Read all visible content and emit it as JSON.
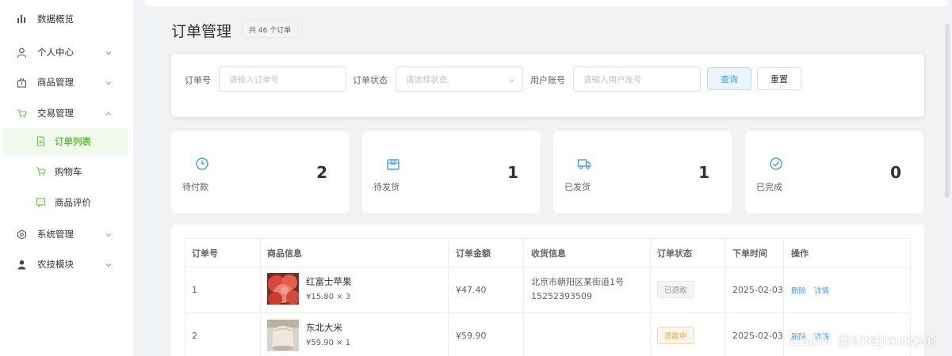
{
  "sidebar": {
    "items": [
      {
        "label": "数据概览",
        "icon": "bar-chart-icon"
      },
      {
        "label": "个人中心",
        "icon": "user-icon"
      },
      {
        "label": "商品管理",
        "icon": "goods-icon"
      },
      {
        "label": "交易管理",
        "icon": "cart-icon"
      },
      {
        "label": "系统管理",
        "icon": "settings-icon"
      },
      {
        "label": "农技模块",
        "icon": "person-icon"
      }
    ],
    "sub_items": [
      {
        "label": "订单列表",
        "icon": "document-icon",
        "active": true
      },
      {
        "label": "购物车",
        "icon": "cart-icon"
      },
      {
        "label": "商品评价",
        "icon": "chat-icon"
      }
    ]
  },
  "header": {
    "title": "订单管理",
    "count_badge": "共 46 个订单"
  },
  "filter": {
    "order_no_label": "订单号",
    "order_no_placeholder": "请输入订单号",
    "status_label": "订单状态",
    "status_placeholder": "请选择状态",
    "account_label": "用户账号",
    "account_placeholder": "请输入用户账号",
    "query_label": "查询",
    "reset_label": "重置"
  },
  "stats": [
    {
      "label": "待付款",
      "value": "2",
      "icon": "clock-icon"
    },
    {
      "label": "待发货",
      "value": "1",
      "icon": "package-icon"
    },
    {
      "label": "已发货",
      "value": "1",
      "icon": "truck-icon"
    },
    {
      "label": "已完成",
      "value": "0",
      "icon": "check-circle-icon"
    }
  ],
  "table": {
    "columns": [
      "订单号",
      "商品信息",
      "订单金额",
      "收货信息",
      "订单状态",
      "下单时间",
      "操作"
    ],
    "rows": [
      {
        "order_no": "1",
        "product_name": "红富士苹果",
        "product_price": "¥15.80 × 3",
        "amount": "¥47.40",
        "address": "北京市朝阳区某街道1号",
        "phone": "15252393509",
        "status": "已退款",
        "time": "2025-02-03",
        "actions": [
          "删除",
          "详情"
        ]
      },
      {
        "order_no": "2",
        "product_name": "东北大米",
        "product_price": "¥59.90 × 1",
        "amount": "¥59.90",
        "address": "",
        "phone": "",
        "status": "退款中",
        "time": "2025-02-03",
        "actions": [
          "删除",
          "详情"
        ]
      }
    ]
  },
  "watermark": "CSDN @shejizuopin",
  "colors": {
    "accent_green": "#67c23a",
    "accent_blue": "#409eff",
    "warning": "#e6a23c"
  }
}
